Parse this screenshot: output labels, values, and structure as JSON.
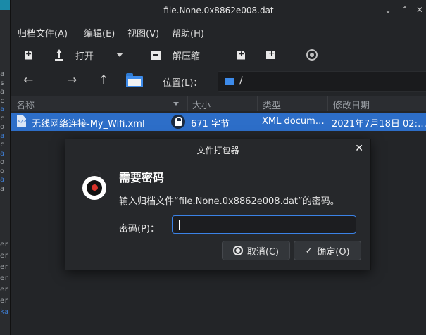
{
  "window": {
    "title": "file.None.0x8862e008.dat",
    "minimize_glyph": "⌄",
    "maximize_glyph": "⌃",
    "close_glyph": "✕"
  },
  "menubar": {
    "items": [
      {
        "label": "归档文件(A)"
      },
      {
        "label": "编辑(E)"
      },
      {
        "label": "视图(V)"
      },
      {
        "label": "帮助(H)"
      }
    ]
  },
  "toolbar": {
    "open_label": "打开",
    "extract_label": "解压缩"
  },
  "navbar": {
    "back_glyph": "←",
    "forward_glyph": "→",
    "up_glyph": "↑",
    "location_label": "位置(L)：",
    "location_path": "/"
  },
  "table": {
    "columns": [
      "名称",
      "大小",
      "类型",
      "修改日期"
    ],
    "rows": [
      {
        "name": "无线网络连接-My_Wifi.xml",
        "size": "671 字节",
        "type": "XML docum…",
        "modified": "2021年7月18日 02:…"
      }
    ]
  },
  "dialog": {
    "title": "文件打包器",
    "close_glyph": "✕",
    "heading": "需要密码",
    "message": "输入归档文件“file.None.0x8862e008.dat”的密码。",
    "password_label": "密码(P)：",
    "password_value": "",
    "cancel_label": "取消(C)",
    "ok_label": "确定(O)",
    "ok_glyph": "✓"
  },
  "background_terminal": {
    "top_lines": [
      "a",
      "s",
      "a",
      "c",
      "a",
      "c",
      "o",
      "a",
      "c",
      "a",
      "o",
      "o",
      "a",
      "a"
    ],
    "bottom_lines": [
      "er",
      "er",
      "er",
      "er",
      "er",
      "er",
      "ka"
    ]
  },
  "colors": {
    "selection": "#2d6ec8",
    "accent": "#3b82e6",
    "lock_red": "#d9342b"
  }
}
